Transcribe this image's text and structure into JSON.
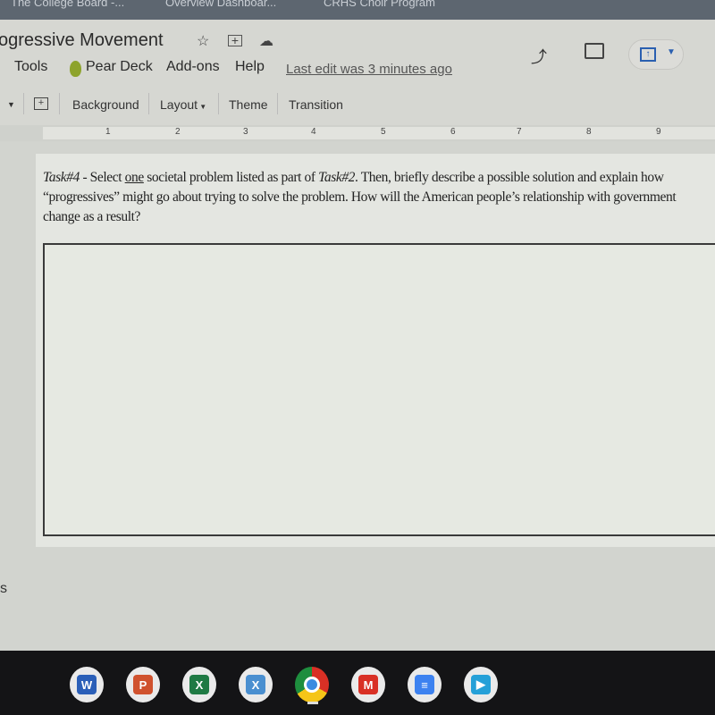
{
  "browser_tabs": [
    "The College Board -...",
    "Overview Dashboar...",
    "CRHS Choir Program"
  ],
  "doc": {
    "title": "ogressive Movement",
    "last_edit": "Last edit was 3 minutes ago"
  },
  "menu": [
    "Tools",
    "Pear Deck",
    "Add-ons",
    "Help"
  ],
  "toolbar": {
    "background": "Background",
    "layout": "Layout",
    "theme": "Theme",
    "transition": "Transition"
  },
  "ruler": [
    "1",
    "2",
    "3",
    "4",
    "5",
    "6",
    "7",
    "8",
    "9"
  ],
  "slide": {
    "task_label": "Task#4",
    "t1": " - Select ",
    "one": "one",
    "t2": " societal problem listed as part of ",
    "task2": "Task#2",
    "t3": ".  Then, briefly describe a possible solution and explain how “progressives” might go about trying to solve the problem.  How will the American people’s relationship with government change as a result?",
    "answer": ""
  },
  "speaker_notes_fragment": "s",
  "dock_apps": [
    {
      "name": "word",
      "letter": "W",
      "color": "#2b5fb8"
    },
    {
      "name": "powerpoint",
      "letter": "P",
      "color": "#d0522e"
    },
    {
      "name": "excel",
      "letter": "X",
      "color": "#1f7a44"
    },
    {
      "name": "xodo",
      "letter": "X",
      "color": "#4a8fd0"
    },
    {
      "name": "chrome",
      "letter": "",
      "color": "#3b8be0"
    },
    {
      "name": "gmail",
      "letter": "M",
      "color": "#d93025"
    },
    {
      "name": "google-docs",
      "letter": "≡",
      "color": "#3d82f0"
    },
    {
      "name": "play-store",
      "letter": "▶",
      "color": "#25a0d8"
    }
  ]
}
